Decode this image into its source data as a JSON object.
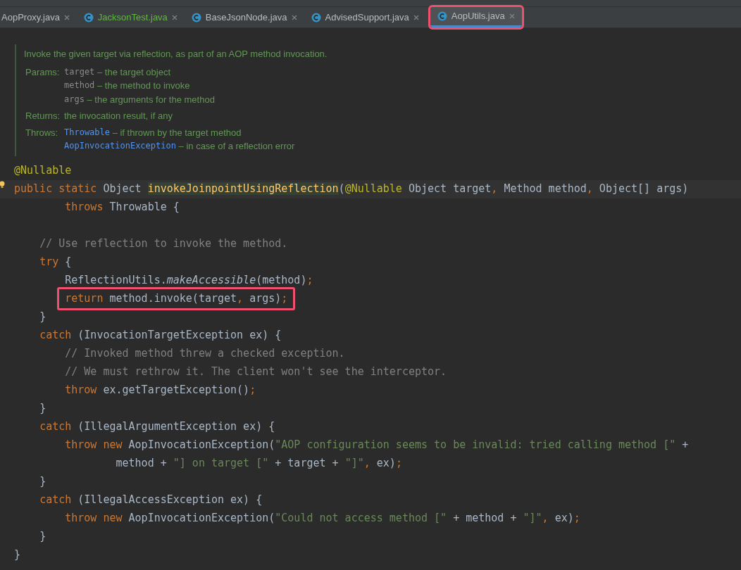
{
  "tabs": [
    {
      "label": "AopProxy.java",
      "selected": false,
      "clipped": true,
      "color": "#bbbbbb",
      "highlighted": false
    },
    {
      "label": "JacksonTest.java",
      "selected": false,
      "clipped": false,
      "color": "#62b543",
      "highlighted": false
    },
    {
      "label": "BaseJsonNode.java",
      "selected": false,
      "clipped": false,
      "color": "#bbbbbb",
      "highlighted": false
    },
    {
      "label": "AdvisedSupport.java",
      "selected": false,
      "clipped": false,
      "color": "#bbbbbb",
      "highlighted": false
    },
    {
      "label": "AopUtils.java",
      "selected": true,
      "clipped": false,
      "color": "#bbbbbb",
      "highlighted": true
    }
  ],
  "doc": {
    "summary": "Invoke the given target via reflection, as part of an AOP method invocation.",
    "sections": [
      {
        "label": "Params:",
        "items": [
          {
            "code": "target",
            "kind": "param",
            "text": " – the target object"
          },
          {
            "code": "method",
            "kind": "param",
            "text": " – the method to invoke"
          },
          {
            "code": "args",
            "kind": "param",
            "text": " – the arguments for the method"
          }
        ]
      },
      {
        "label": "Returns:",
        "items": [
          {
            "text": "the invocation result, if any"
          }
        ]
      },
      {
        "label": "Throws:",
        "items": [
          {
            "code": "Throwable",
            "kind": "link",
            "text": " – if thrown by the target method"
          },
          {
            "code": "AopInvocationException",
            "kind": "link",
            "text": " – in case of a reflection error"
          }
        ]
      }
    ]
  },
  "code": [
    {
      "kind": "code",
      "current": false,
      "highlighted": false,
      "tokens": [
        {
          "kind": "ann",
          "t": "@Nullable"
        }
      ]
    },
    {
      "kind": "code",
      "current": true,
      "highlighted": false,
      "tokens": [
        {
          "kind": "kw",
          "t": "public static"
        },
        {
          "kind": "plain",
          "t": " Object "
        },
        {
          "kind": "fn",
          "t": "invokeJoinpointUsingReflection"
        },
        {
          "kind": "plain",
          "t": "("
        },
        {
          "kind": "ann",
          "t": "@Nullable"
        },
        {
          "kind": "plain",
          "t": " Object target"
        },
        {
          "kind": "punc",
          "t": ","
        },
        {
          "kind": "plain",
          "t": " Method method"
        },
        {
          "kind": "punc",
          "t": ","
        },
        {
          "kind": "plain",
          "t": " Object[] args)"
        }
      ]
    },
    {
      "kind": "code",
      "current": false,
      "highlighted": false,
      "tokens": [
        {
          "kind": "kw",
          "t": "        throws"
        },
        {
          "kind": "plain",
          "t": " Throwable {"
        }
      ]
    },
    {
      "kind": "blank",
      "current": false
    },
    {
      "kind": "code",
      "current": false,
      "highlighted": false,
      "tokens": [
        {
          "kind": "com",
          "t": "    // Use reflection to invoke the method."
        }
      ]
    },
    {
      "kind": "code",
      "current": false,
      "highlighted": false,
      "tokens": [
        {
          "kind": "kw",
          "t": "    try"
        },
        {
          "kind": "plain",
          "t": " {"
        }
      ]
    },
    {
      "kind": "code",
      "current": false,
      "highlighted": false,
      "tokens": [
        {
          "kind": "plain",
          "t": "        ReflectionUtils."
        },
        {
          "kind": "italic",
          "t": "makeAccessible"
        },
        {
          "kind": "plain",
          "t": "(method)"
        },
        {
          "kind": "punc",
          "t": ";"
        }
      ]
    },
    {
      "kind": "code",
      "current": false,
      "highlighted": true,
      "tokens": [
        {
          "kind": "kw",
          "t": "        return"
        },
        {
          "kind": "plain",
          "t": " method.invoke(target"
        },
        {
          "kind": "punc",
          "t": ","
        },
        {
          "kind": "plain",
          "t": " args)"
        },
        {
          "kind": "punc",
          "t": ";"
        }
      ]
    },
    {
      "kind": "code",
      "current": false,
      "highlighted": false,
      "tokens": [
        {
          "kind": "plain",
          "t": "    }"
        }
      ]
    },
    {
      "kind": "code",
      "current": false,
      "highlighted": false,
      "tokens": [
        {
          "kind": "kw",
          "t": "    catch"
        },
        {
          "kind": "plain",
          "t": " (InvocationTargetException ex) {"
        }
      ]
    },
    {
      "kind": "code",
      "current": false,
      "highlighted": false,
      "tokens": [
        {
          "kind": "com",
          "t": "        // Invoked method threw a checked exception."
        }
      ]
    },
    {
      "kind": "code",
      "current": false,
      "highlighted": false,
      "tokens": [
        {
          "kind": "com",
          "t": "        // We must rethrow it. The client won't see the interceptor."
        }
      ]
    },
    {
      "kind": "code",
      "current": false,
      "highlighted": false,
      "tokens": [
        {
          "kind": "kw",
          "t": "        throw"
        },
        {
          "kind": "plain",
          "t": " ex.getTargetException()"
        },
        {
          "kind": "punc",
          "t": ";"
        }
      ]
    },
    {
      "kind": "code",
      "current": false,
      "highlighted": false,
      "tokens": [
        {
          "kind": "plain",
          "t": "    }"
        }
      ]
    },
    {
      "kind": "code",
      "current": false,
      "highlighted": false,
      "tokens": [
        {
          "kind": "kw",
          "t": "    catch"
        },
        {
          "kind": "plain",
          "t": " (IllegalArgumentException ex) {"
        }
      ]
    },
    {
      "kind": "code",
      "current": false,
      "highlighted": false,
      "tokens": [
        {
          "kind": "kw",
          "t": "        throw new"
        },
        {
          "kind": "plain",
          "t": " AopInvocationException("
        },
        {
          "kind": "str",
          "t": "\"AOP configuration seems to be invalid: tried calling method [\""
        },
        {
          "kind": "plain",
          "t": " +"
        }
      ]
    },
    {
      "kind": "code",
      "current": false,
      "highlighted": false,
      "tokens": [
        {
          "kind": "plain",
          "t": "                method + "
        },
        {
          "kind": "str",
          "t": "\"] on target [\""
        },
        {
          "kind": "plain",
          "t": " + target + "
        },
        {
          "kind": "str",
          "t": "\"]\""
        },
        {
          "kind": "punc",
          "t": ","
        },
        {
          "kind": "plain",
          "t": " ex)"
        },
        {
          "kind": "punc",
          "t": ";"
        }
      ]
    },
    {
      "kind": "code",
      "current": false,
      "highlighted": false,
      "tokens": [
        {
          "kind": "plain",
          "t": "    }"
        }
      ]
    },
    {
      "kind": "code",
      "current": false,
      "highlighted": false,
      "tokens": [
        {
          "kind": "kw",
          "t": "    catch"
        },
        {
          "kind": "plain",
          "t": " (IllegalAccessException ex) {"
        }
      ]
    },
    {
      "kind": "code",
      "current": false,
      "highlighted": false,
      "tokens": [
        {
          "kind": "kw",
          "t": "        throw new"
        },
        {
          "kind": "plain",
          "t": " AopInvocationException("
        },
        {
          "kind": "str",
          "t": "\"Could not access method [\""
        },
        {
          "kind": "plain",
          "t": " + method + "
        },
        {
          "kind": "str",
          "t": "\"]\""
        },
        {
          "kind": "punc",
          "t": ","
        },
        {
          "kind": "plain",
          "t": " ex)"
        },
        {
          "kind": "punc",
          "t": ";"
        }
      ]
    },
    {
      "kind": "code",
      "current": false,
      "highlighted": false,
      "tokens": [
        {
          "kind": "plain",
          "t": "    }"
        }
      ]
    },
    {
      "kind": "code",
      "current": false,
      "highlighted": false,
      "tokens": [
        {
          "kind": "plain",
          "t": "}"
        }
      ]
    }
  ]
}
